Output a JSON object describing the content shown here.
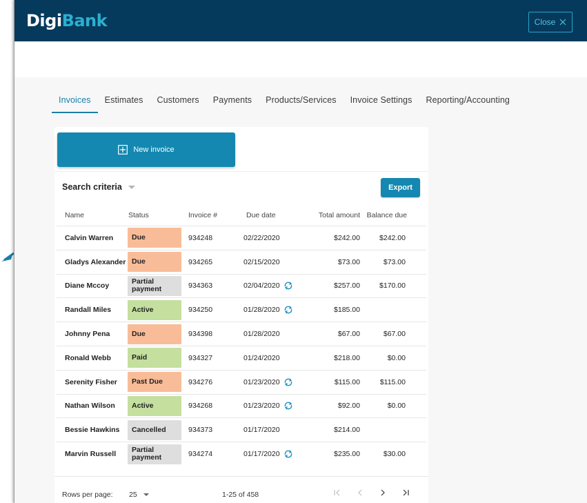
{
  "brand": {
    "prefix": "Digi",
    "suffix": "Bank"
  },
  "header": {
    "close_label": "Close"
  },
  "tabs": [
    {
      "label": "Invoices",
      "active": true
    },
    {
      "label": "Estimates",
      "active": false
    },
    {
      "label": "Customers",
      "active": false
    },
    {
      "label": "Payments",
      "active": false
    },
    {
      "label": "Products/Services",
      "active": false
    },
    {
      "label": "Invoice Settings",
      "active": false
    },
    {
      "label": "Reporting/Accounting",
      "active": false
    }
  ],
  "actions": {
    "new_invoice_label": "New invoice",
    "export_label": "Export"
  },
  "search": {
    "label": "Search criteria"
  },
  "table": {
    "columns": [
      "Name",
      "Status",
      "Invoice #",
      "Due date",
      "Total amount",
      "Balance due"
    ],
    "rows": [
      {
        "name": "Calvin Warren",
        "status": "Due",
        "status_type": "due",
        "invoice": "934248",
        "due_date": "02/22/2020",
        "recurring": false,
        "total": "$242.00",
        "balance": "$242.00"
      },
      {
        "name": "Gladys Alexander",
        "status": "Due",
        "status_type": "due",
        "invoice": "934265",
        "due_date": "02/15/2020",
        "recurring": false,
        "total": "$73.00",
        "balance": "$73.00"
      },
      {
        "name": "Diane Mccoy",
        "status": "Partial payment",
        "status_type": "partial",
        "invoice": "934363",
        "due_date": "02/04/2020",
        "recurring": true,
        "total": "$257.00",
        "balance": "$170.00"
      },
      {
        "name": "Randall Miles",
        "status": "Active",
        "status_type": "active",
        "invoice": "934250",
        "due_date": "01/28/2020",
        "recurring": true,
        "total": "$185.00",
        "balance": ""
      },
      {
        "name": "Johnny Pena",
        "status": "Due",
        "status_type": "due",
        "invoice": "934398",
        "due_date": "01/28/2020",
        "recurring": false,
        "total": "$67.00",
        "balance": "$67.00"
      },
      {
        "name": "Ronald Webb",
        "status": "Paid",
        "status_type": "paid",
        "invoice": "934327",
        "due_date": "01/24/2020",
        "recurring": false,
        "total": "$218.00",
        "balance": "$0.00"
      },
      {
        "name": "Serenity Fisher",
        "status": "Past Due",
        "status_type": "pastdue",
        "invoice": "934276",
        "due_date": "01/23/2020",
        "recurring": true,
        "total": "$115.00",
        "balance": "$115.00"
      },
      {
        "name": "Nathan Wilson",
        "status": "Active",
        "status_type": "active",
        "invoice": "934268",
        "due_date": "01/23/2020",
        "recurring": true,
        "total": "$92.00",
        "balance": "$0.00"
      },
      {
        "name": "Bessie Hawkins",
        "status": "Cancelled",
        "status_type": "cancelled",
        "invoice": "934373",
        "due_date": "01/17/2020",
        "recurring": false,
        "total": "$214.00",
        "balance": ""
      },
      {
        "name": "Marvin Russell",
        "status": "Partial payment",
        "status_type": "partial",
        "invoice": "934274",
        "due_date": "01/17/2020",
        "recurring": true,
        "total": "$235.00",
        "balance": "$30.00"
      }
    ]
  },
  "pagination": {
    "rows_per_page_label": "Rows per page:",
    "rows_per_page_value": "25",
    "range_label": "1-25 of 458"
  },
  "colors": {
    "header_bg": "#063a5c",
    "primary": "#1488b0",
    "due": "#f9bc98",
    "active": "#c4df9e",
    "neutral": "#dedede"
  }
}
